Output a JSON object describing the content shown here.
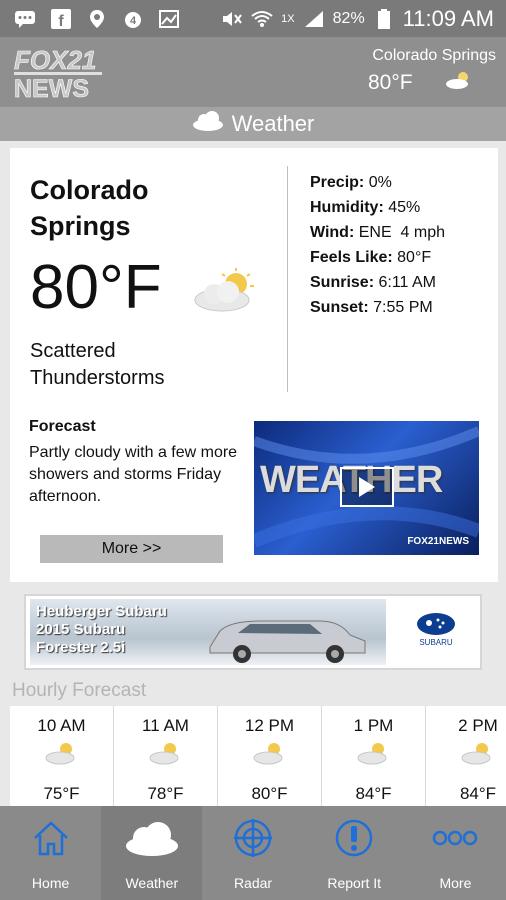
{
  "status_bar": {
    "network_label": "1X",
    "battery": "82%",
    "time": "11:09 AM"
  },
  "app_header": {
    "logo_text_top": "FOX21",
    "logo_text_bottom": "NEWS",
    "city": "Colorado Springs",
    "temp": "80°F"
  },
  "section": {
    "title": "Weather"
  },
  "current": {
    "city": "Colorado Springs",
    "temp": "80°F",
    "condition": "Scattered Thunderstorms",
    "details": [
      {
        "label": "Precip:",
        "value": "0%"
      },
      {
        "label": "Humidity:",
        "value": "45%"
      },
      {
        "label": "Wind:",
        "value": "ENE  4 mph"
      },
      {
        "label": "Feels Like:",
        "value": "80°F"
      },
      {
        "label": "Sunrise:",
        "value": "6:11 AM"
      },
      {
        "label": "Sunset:",
        "value": "7:55 PM"
      }
    ],
    "forecast_title": "Forecast",
    "forecast_text": "Partly cloudy with a few more showers and storms Friday afternoon.",
    "more_label": "More >>",
    "video_title": "WEATHER",
    "video_logo": "FOX21NEWS"
  },
  "ad": {
    "line1": "Heuberger Subaru",
    "line2": "2015 Subaru",
    "line3": "Forester 2.5i",
    "brand": "SUBARU"
  },
  "hourly": {
    "title": "Hourly Forecast",
    "items": [
      {
        "time": "10 AM",
        "temp": "75°F"
      },
      {
        "time": "11 AM",
        "temp": "78°F"
      },
      {
        "time": "12 PM",
        "temp": "80°F"
      },
      {
        "time": "1 PM",
        "temp": "84°F"
      },
      {
        "time": "2 PM",
        "temp": "84°F"
      }
    ]
  },
  "nav": {
    "items": [
      {
        "label": "Home",
        "icon": "home-icon"
      },
      {
        "label": "Weather",
        "icon": "cloud-icon"
      },
      {
        "label": "Radar",
        "icon": "radar-icon"
      },
      {
        "label": "Report It",
        "icon": "alert-icon"
      },
      {
        "label": "More",
        "icon": "more-icon"
      }
    ]
  },
  "colors": {
    "status_bar": "#7a7a7a",
    "header": "#8f8f8f",
    "section_bar": "#a3a3a3",
    "nav_icon": "#1f6fd6"
  }
}
